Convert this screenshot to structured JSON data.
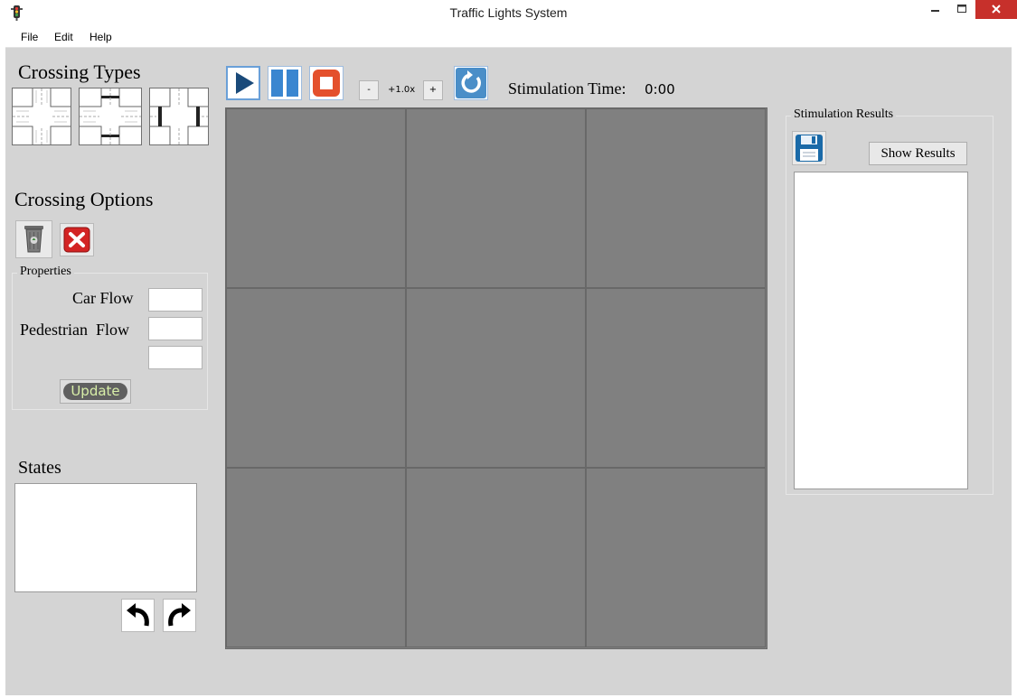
{
  "window": {
    "title": "Traffic Lights System"
  },
  "menu": [
    "File",
    "Edit",
    "Help"
  ],
  "crossing_types": {
    "heading": "Crossing Types",
    "items": [
      "crossing-type-plain",
      "crossing-type-crosswalk",
      "crossing-type-side-crosswalk"
    ]
  },
  "crossing_options": {
    "heading": "Crossing Options"
  },
  "properties": {
    "title": "Properties",
    "car_flow_label": "Car Flow",
    "pedestrian_flow_label": "Pedestrian  Flow",
    "car_flow_value": "",
    "pedestrian_flow_value": "",
    "extra_value": "",
    "update_label": "Update"
  },
  "states": {
    "heading": "States",
    "items": []
  },
  "toolbar": {
    "minus_label": "-",
    "speed_label": "+1.0x",
    "plus_label": "+",
    "time_label": "Stimulation Time:",
    "time_value": "0:00"
  },
  "grid": {
    "rows": 3,
    "cols": 3,
    "cell_color": "#808080"
  },
  "results": {
    "title": "Stimulation Results",
    "show_label": "Show Results",
    "items": []
  },
  "colors": {
    "background": "#d4d4d4",
    "close_button": "#c7302b",
    "play_icon": "#1a4a7a",
    "pause_icon": "#3a86d0",
    "stop_icon": "#e4502c",
    "refresh_icon": "#4a8ec8"
  }
}
